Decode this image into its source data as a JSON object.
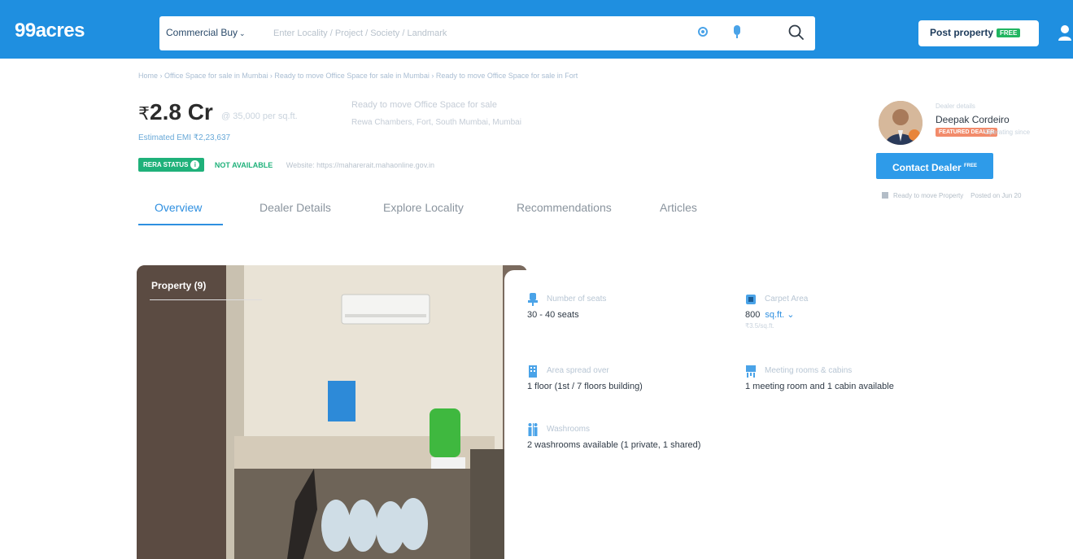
{
  "header": {
    "logo": "99acres",
    "search_category": "Commercial Buy",
    "search_placeholder": "Enter Locality / Project / Society / Landmark",
    "post_property_label": "Post property",
    "post_property_badge": "FREE",
    "accent": "#1f8fe0"
  },
  "breadcrumb": "Home › Office Space for sale in Mumbai › Ready to move Office Space for sale in Mumbai › Ready to move Office Space for sale in Fort",
  "listing": {
    "price_symbol": "₹",
    "price": "2.8 Cr",
    "per_sqft": "@ 35,000 per sq.ft.",
    "emi": "Estimated EMI ₹2,23,637",
    "title": "Ready to move Office Space for sale",
    "location": "Rewa Chambers, Fort, South Mumbai, Mumbai"
  },
  "rera": {
    "badge": "RERA STATUS",
    "status": "NOT AVAILABLE",
    "website": "Website: https://maharerait.mahaonline.gov.in"
  },
  "tabs": [
    {
      "label": "Overview",
      "active": true
    },
    {
      "label": "Dealer Details",
      "active": false
    },
    {
      "label": "Explore Locality",
      "active": false
    },
    {
      "label": "Recommendations",
      "active": false
    },
    {
      "label": "Articles",
      "active": false
    }
  ],
  "dealer": {
    "meta": "Dealer details",
    "name": "Deepak Cordeiro",
    "featured_badge": "FEATURED DEALER",
    "featured_sub": "Operating since",
    "contact_label": "Contact Dealer",
    "contact_badge": "FREE",
    "footer_status": "Ready to move Property",
    "footer_posted": "Posted on Jun 20"
  },
  "gallery": {
    "label": "Property (9)"
  },
  "details": [
    {
      "icon": "seat-icon",
      "label": "Number of seats",
      "value": "30 - 40 seats"
    },
    {
      "icon": "area-icon",
      "label": "Carpet Area",
      "value": "800",
      "unit": "sq.ft.",
      "sub": "₹3.5/sq.ft."
    },
    {
      "icon": "floor-icon",
      "label": "Area spread over",
      "value": "1 floor (1st / 7 floors building)"
    },
    {
      "icon": "meeting-room-icon",
      "label": "Meeting rooms & cabins",
      "value": "1 meeting room and 1 cabin available"
    },
    {
      "icon": "washroom-icon",
      "label": "Washrooms",
      "value": "2 washrooms available (1 private, 1 shared)"
    }
  ]
}
